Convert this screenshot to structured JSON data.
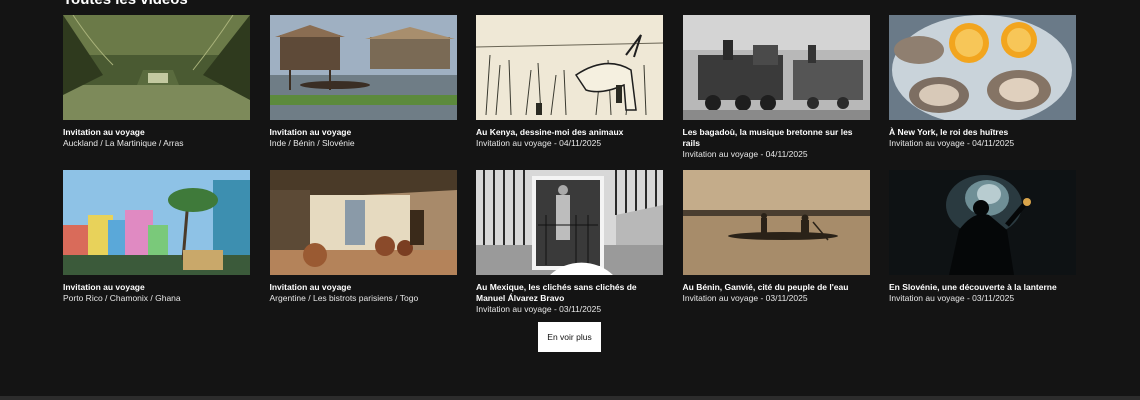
{
  "section": {
    "title": "Toutes les vidéos"
  },
  "videos": [
    {
      "title": "Invitation au voyage",
      "subtitle": "Auckland / La Martinique / Arras",
      "thumb": "mangrove-river-thumbnail"
    },
    {
      "title": "Invitation au voyage",
      "subtitle": "Inde / Bénin / Slovénie",
      "thumb": "stilt-houses-thumbnail"
    },
    {
      "title": "Au Kenya, dessine-moi des animaux",
      "subtitle": "Invitation au voyage - 04/11/2025",
      "thumb": "animal-drawing-thumbnail"
    },
    {
      "title": "Les bagadoù, la musique bretonne sur les rails",
      "subtitle": "Invitation au voyage - 04/11/2025",
      "thumb": "steam-train-thumbnail"
    },
    {
      "title": "À New York, le roi des huîtres",
      "subtitle": "Invitation au voyage - 04/11/2025",
      "thumb": "oysters-thumbnail"
    },
    {
      "title": "Invitation au voyage",
      "subtitle": "Porto Rico / Chamonix / Ghana",
      "thumb": "colorful-houses-thumbnail"
    },
    {
      "title": "Invitation au voyage",
      "subtitle": "Argentine / Les bistrots parisiens / Togo",
      "thumb": "village-courtyard-thumbnail"
    },
    {
      "title": "Au Mexique, les clichés sans clichés de Manuel Álvarez Bravo",
      "subtitle": "Invitation au voyage - 03/11/2025",
      "thumb": "mexico-photo-thumbnail"
    },
    {
      "title": "Au Bénin, Ganvié, cité du peuple de l'eau",
      "subtitle": "Invitation au voyage - 03/11/2025",
      "thumb": "lake-canoe-thumbnail"
    },
    {
      "title": "En Slovénie, une découverte à la lanterne",
      "subtitle": "Invitation au voyage - 03/11/2025",
      "thumb": "cave-lantern-thumbnail"
    }
  ],
  "more_button": {
    "label": "En voir plus"
  },
  "colors": {
    "background": "#141414",
    "text": "#ffffff",
    "button_bg": "#ffffff",
    "button_text": "#111111"
  }
}
